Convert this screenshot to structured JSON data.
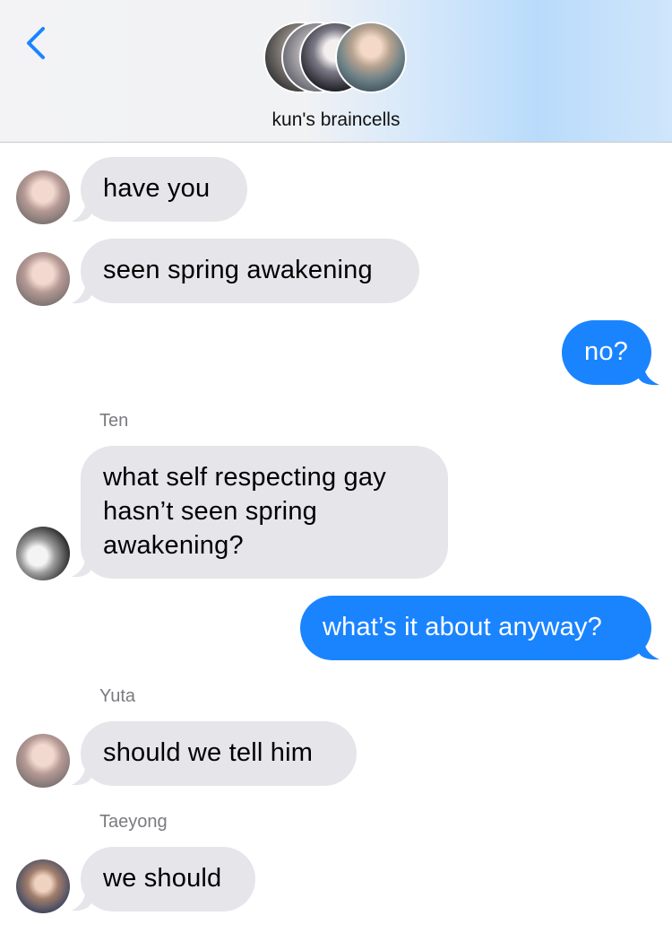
{
  "header": {
    "back_icon": "chevron-left-icon",
    "group_name": "kun's braincells",
    "accent": "#1a84ff"
  },
  "colors": {
    "incoming_bubble": "#e5e5ea",
    "outgoing_bubble": "#1a84ff",
    "sender_label": "#7a7a80"
  },
  "messages": [
    {
      "direction": "incoming",
      "text": "have you"
    },
    {
      "direction": "incoming",
      "text": "seen spring awakening"
    },
    {
      "direction": "outgoing",
      "text": "no?"
    },
    {
      "direction": "incoming",
      "sender": "Ten",
      "lines": [
        "what self respecting gay",
        "hasn’t seen spring",
        "awakening?"
      ]
    },
    {
      "direction": "outgoing",
      "text": "what’s it about anyway?"
    },
    {
      "direction": "incoming",
      "sender": "Yuta",
      "text": "should we tell him"
    },
    {
      "direction": "incoming",
      "sender": "Taeyong",
      "text": "we should"
    }
  ]
}
